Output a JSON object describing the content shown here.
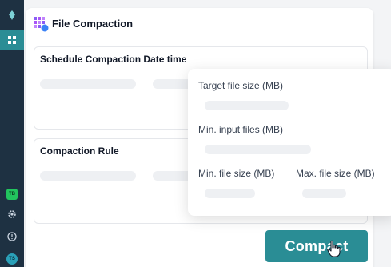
{
  "sidebar": {
    "tb_badge": "TB",
    "avatar": "TS",
    "icons": [
      "diamond-logo-icon",
      "grid-icon",
      "settings-icon",
      "help-icon"
    ]
  },
  "header": {
    "title": "File Compaction"
  },
  "schedule": {
    "title": "Schedule Compaction Date time"
  },
  "rule": {
    "title": "Compaction Rule"
  },
  "popover": {
    "target_size_label": "Target file size (MB)",
    "min_input_label": "Min. input files (MB)",
    "min_size_label": "Min. file size (MB)",
    "max_size_label": "Max. file size (MB)"
  },
  "compact_button": {
    "label": "Compact"
  },
  "colors": {
    "accent": "#2a8d95",
    "sidebar": "#1e3142",
    "badge": "#22c55e"
  }
}
